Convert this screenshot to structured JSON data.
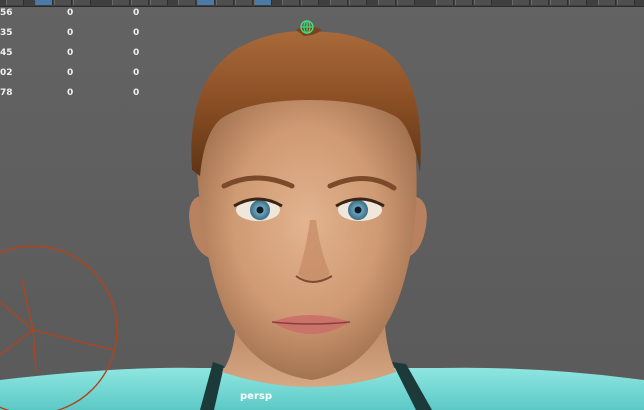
{
  "viewport": {
    "camera_label": "persp"
  },
  "hud": {
    "rows": [
      {
        "label": "56",
        "v1": "0",
        "v2": "0"
      },
      {
        "label": "35",
        "v1": "0",
        "v2": "0"
      },
      {
        "label": "45",
        "v1": "0",
        "v2": "0"
      },
      {
        "label": "02",
        "v1": "0",
        "v2": "0"
      },
      {
        "label": "78",
        "v1": "0",
        "v2": "0"
      }
    ]
  },
  "colors": {
    "viewport_bg": "#5e5e5e",
    "joint_manipulator": "#b0441c",
    "selection_handle": "#3fdf7a",
    "active_toolbar": "#4c7aa7"
  },
  "icons": [
    "rotate-manipulator-icon",
    "selection-handle-icon"
  ]
}
